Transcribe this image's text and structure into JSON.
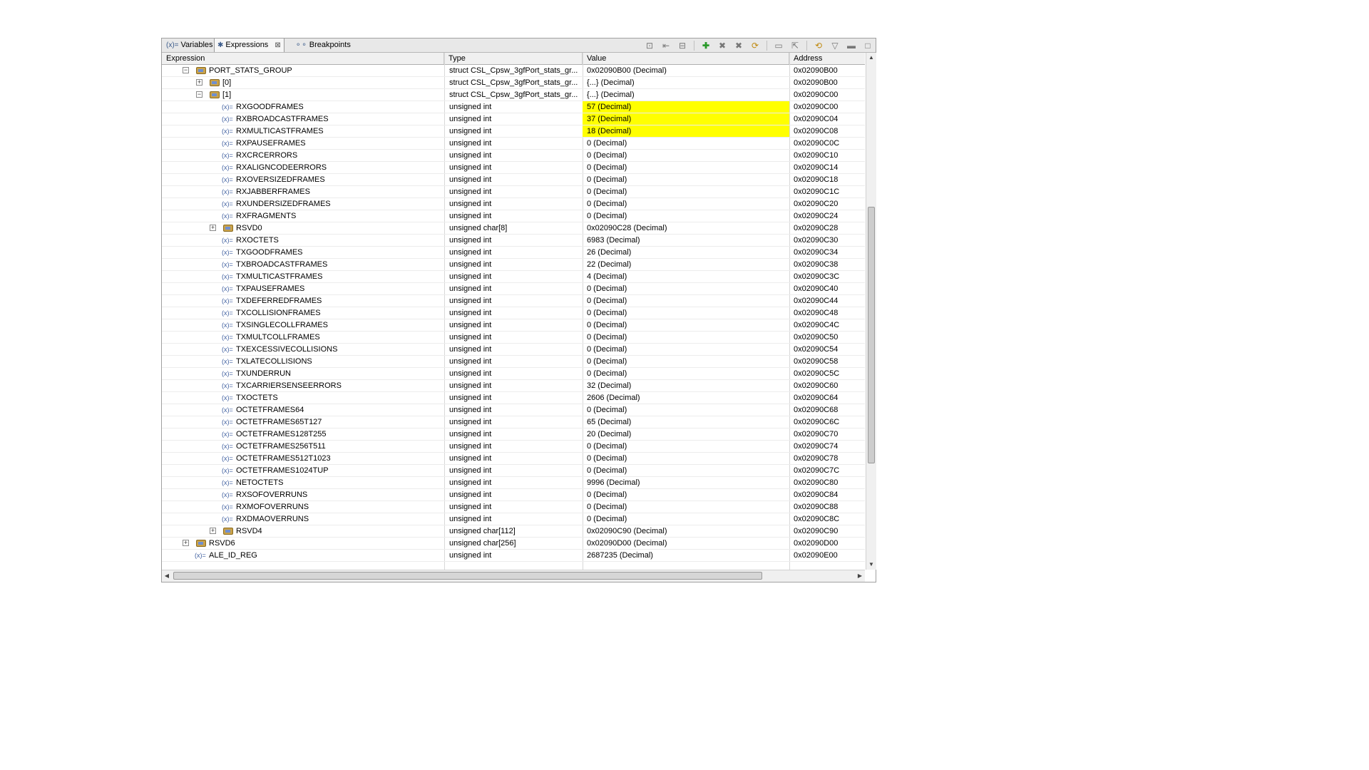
{
  "tabs": [
    {
      "label": "Variables",
      "icon": "variables-icon",
      "active": false
    },
    {
      "label": "Expressions",
      "icon": "expressions-icon",
      "active": true
    },
    {
      "label": "Breakpoints",
      "icon": "breakpoints-icon",
      "active": false
    }
  ],
  "toolbar": [
    "show-type-names-icon",
    "collapse-all-icon",
    "remove-expression-icon",
    "add-expression-icon",
    "remove-icon",
    "remove-all-icon",
    "refresh-icon",
    "new-view-icon",
    "pin-icon",
    "continuous-refresh-icon",
    "view-menu-icon",
    "minimize-icon",
    "maximize-icon"
  ],
  "columns": {
    "expression": "Expression",
    "type": "Type",
    "value": "Value",
    "address": "Address"
  },
  "colors": {
    "highlight": "#ffff00"
  },
  "rows": [
    {
      "indent": 2,
      "twisty": "−",
      "icon": "struct",
      "name": "PORT_STATS_GROUP",
      "type": "struct CSL_Cpsw_3gfPort_stats_gr...",
      "value": "0x02090B00 (Decimal)",
      "address": "0x02090B00",
      "changed": false
    },
    {
      "indent": 3,
      "twisty": "+",
      "icon": "struct",
      "name": "[0]",
      "type": "struct CSL_Cpsw_3gfPort_stats_gr...",
      "value": "{...} (Decimal)",
      "address": "0x02090B00",
      "changed": false
    },
    {
      "indent": 3,
      "twisty": "−",
      "icon": "struct-open",
      "name": "[1]",
      "type": "struct CSL_Cpsw_3gfPort_stats_gr...",
      "value": "{...} (Decimal)",
      "address": "0x02090C00",
      "changed": false
    },
    {
      "indent": 4,
      "icon": "var",
      "name": "RXGOODFRAMES",
      "type": "unsigned int",
      "value": "57 (Decimal)",
      "address": "0x02090C00",
      "changed": true
    },
    {
      "indent": 4,
      "icon": "var",
      "name": "RXBROADCASTFRAMES",
      "type": "unsigned int",
      "value": "37 (Decimal)",
      "address": "0x02090C04",
      "changed": true
    },
    {
      "indent": 4,
      "icon": "var",
      "name": "RXMULTICASTFRAMES",
      "type": "unsigned int",
      "value": "18 (Decimal)",
      "address": "0x02090C08",
      "changed": true
    },
    {
      "indent": 4,
      "icon": "var",
      "name": "RXPAUSEFRAMES",
      "type": "unsigned int",
      "value": "0 (Decimal)",
      "address": "0x02090C0C",
      "changed": false
    },
    {
      "indent": 4,
      "icon": "var",
      "name": "RXCRCERRORS",
      "type": "unsigned int",
      "value": "0 (Decimal)",
      "address": "0x02090C10",
      "changed": false
    },
    {
      "indent": 4,
      "icon": "var",
      "name": "RXALIGNCODEERRORS",
      "type": "unsigned int",
      "value": "0 (Decimal)",
      "address": "0x02090C14",
      "changed": false
    },
    {
      "indent": 4,
      "icon": "var",
      "name": "RXOVERSIZEDFRAMES",
      "type": "unsigned int",
      "value": "0 (Decimal)",
      "address": "0x02090C18",
      "changed": false
    },
    {
      "indent": 4,
      "icon": "var",
      "name": "RXJABBERFRAMES",
      "type": "unsigned int",
      "value": "0 (Decimal)",
      "address": "0x02090C1C",
      "changed": false
    },
    {
      "indent": 4,
      "icon": "var",
      "name": "RXUNDERSIZEDFRAMES",
      "type": "unsigned int",
      "value": "0 (Decimal)",
      "address": "0x02090C20",
      "changed": false
    },
    {
      "indent": 4,
      "icon": "var",
      "name": "RXFRAGMENTS",
      "type": "unsigned int",
      "value": "0 (Decimal)",
      "address": "0x02090C24",
      "changed": false
    },
    {
      "indent": 4,
      "twisty": "+",
      "icon": "struct",
      "name": "RSVD0",
      "type": "unsigned char[8]",
      "value": "0x02090C28 (Decimal)",
      "address": "0x02090C28",
      "changed": false
    },
    {
      "indent": 4,
      "icon": "var",
      "name": "RXOCTETS",
      "type": "unsigned int",
      "value": "6983 (Decimal)",
      "address": "0x02090C30",
      "changed": false
    },
    {
      "indent": 4,
      "icon": "var",
      "name": "TXGOODFRAMES",
      "type": "unsigned int",
      "value": "26 (Decimal)",
      "address": "0x02090C34",
      "changed": false
    },
    {
      "indent": 4,
      "icon": "var",
      "name": "TXBROADCASTFRAMES",
      "type": "unsigned int",
      "value": "22 (Decimal)",
      "address": "0x02090C38",
      "changed": false
    },
    {
      "indent": 4,
      "icon": "var",
      "name": "TXMULTICASTFRAMES",
      "type": "unsigned int",
      "value": "4 (Decimal)",
      "address": "0x02090C3C",
      "changed": false
    },
    {
      "indent": 4,
      "icon": "var",
      "name": "TXPAUSEFRAMES",
      "type": "unsigned int",
      "value": "0 (Decimal)",
      "address": "0x02090C40",
      "changed": false
    },
    {
      "indent": 4,
      "icon": "var",
      "name": "TXDEFERREDFRAMES",
      "type": "unsigned int",
      "value": "0 (Decimal)",
      "address": "0x02090C44",
      "changed": false
    },
    {
      "indent": 4,
      "icon": "var",
      "name": "TXCOLLISIONFRAMES",
      "type": "unsigned int",
      "value": "0 (Decimal)",
      "address": "0x02090C48",
      "changed": false
    },
    {
      "indent": 4,
      "icon": "var",
      "name": "TXSINGLECOLLFRAMES",
      "type": "unsigned int",
      "value": "0 (Decimal)",
      "address": "0x02090C4C",
      "changed": false
    },
    {
      "indent": 4,
      "icon": "var",
      "name": "TXMULTCOLLFRAMES",
      "type": "unsigned int",
      "value": "0 (Decimal)",
      "address": "0x02090C50",
      "changed": false
    },
    {
      "indent": 4,
      "icon": "var",
      "name": "TXEXCESSIVECOLLISIONS",
      "type": "unsigned int",
      "value": "0 (Decimal)",
      "address": "0x02090C54",
      "changed": false
    },
    {
      "indent": 4,
      "icon": "var",
      "name": "TXLATECOLLISIONS",
      "type": "unsigned int",
      "value": "0 (Decimal)",
      "address": "0x02090C58",
      "changed": false
    },
    {
      "indent": 4,
      "icon": "var",
      "name": "TXUNDERRUN",
      "type": "unsigned int",
      "value": "0 (Decimal)",
      "address": "0x02090C5C",
      "changed": false
    },
    {
      "indent": 4,
      "icon": "var",
      "name": "TXCARRIERSENSEERRORS",
      "type": "unsigned int",
      "value": "32 (Decimal)",
      "address": "0x02090C60",
      "changed": false
    },
    {
      "indent": 4,
      "icon": "var",
      "name": "TXOCTETS",
      "type": "unsigned int",
      "value": "2606 (Decimal)",
      "address": "0x02090C64",
      "changed": false
    },
    {
      "indent": 4,
      "icon": "var",
      "name": "OCTETFRAMES64",
      "type": "unsigned int",
      "value": "0 (Decimal)",
      "address": "0x02090C68",
      "changed": false
    },
    {
      "indent": 4,
      "icon": "var",
      "name": "OCTETFRAMES65T127",
      "type": "unsigned int",
      "value": "65 (Decimal)",
      "address": "0x02090C6C",
      "changed": false
    },
    {
      "indent": 4,
      "icon": "var",
      "name": "OCTETFRAMES128T255",
      "type": "unsigned int",
      "value": "20 (Decimal)",
      "address": "0x02090C70",
      "changed": false
    },
    {
      "indent": 4,
      "icon": "var",
      "name": "OCTETFRAMES256T511",
      "type": "unsigned int",
      "value": "0 (Decimal)",
      "address": "0x02090C74",
      "changed": false
    },
    {
      "indent": 4,
      "icon": "var",
      "name": "OCTETFRAMES512T1023",
      "type": "unsigned int",
      "value": "0 (Decimal)",
      "address": "0x02090C78",
      "changed": false
    },
    {
      "indent": 4,
      "icon": "var",
      "name": "OCTETFRAMES1024TUP",
      "type": "unsigned int",
      "value": "0 (Decimal)",
      "address": "0x02090C7C",
      "changed": false
    },
    {
      "indent": 4,
      "icon": "var",
      "name": "NETOCTETS",
      "type": "unsigned int",
      "value": "9996 (Decimal)",
      "address": "0x02090C80",
      "changed": false
    },
    {
      "indent": 4,
      "icon": "var",
      "name": "RXSOFOVERRUNS",
      "type": "unsigned int",
      "value": "0 (Decimal)",
      "address": "0x02090C84",
      "changed": false
    },
    {
      "indent": 4,
      "icon": "var",
      "name": "RXMOFOVERRUNS",
      "type": "unsigned int",
      "value": "0 (Decimal)",
      "address": "0x02090C88",
      "changed": false
    },
    {
      "indent": 4,
      "icon": "var",
      "name": "RXDMAOVERRUNS",
      "type": "unsigned int",
      "value": "0 (Decimal)",
      "address": "0x02090C8C",
      "changed": false
    },
    {
      "indent": 4,
      "twisty": "+",
      "icon": "struct",
      "name": "RSVD4",
      "type": "unsigned char[112]",
      "value": "0x02090C90 (Decimal)",
      "address": "0x02090C90",
      "changed": false
    },
    {
      "indent": 2,
      "twisty": "+",
      "icon": "struct",
      "name": "RSVD6",
      "type": "unsigned char[256]",
      "value": "0x02090D00 (Decimal)",
      "address": "0x02090D00",
      "changed": false
    },
    {
      "indent": 2,
      "icon": "var",
      "name": "ALE_ID_REG",
      "type": "unsigned int",
      "value": "2687235 (Decimal)",
      "address": "0x02090E00",
      "changed": false
    }
  ]
}
